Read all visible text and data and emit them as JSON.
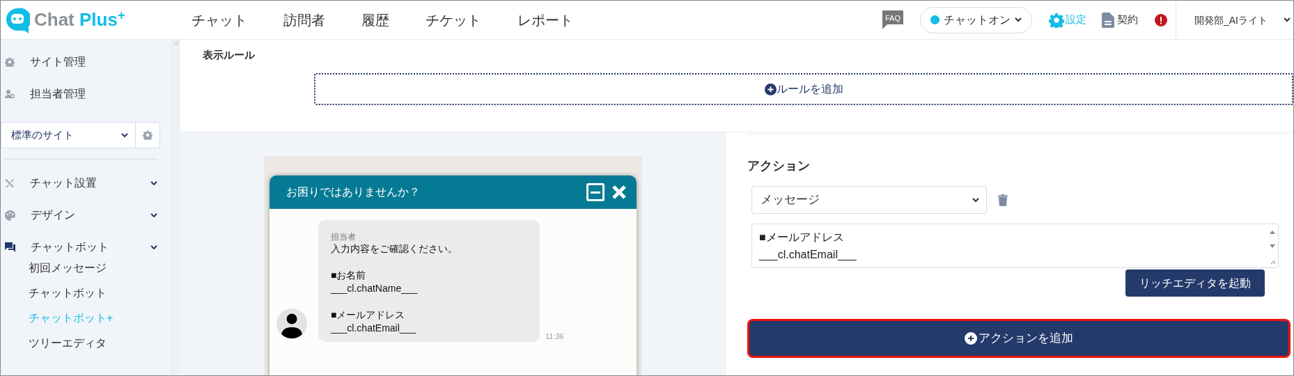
{
  "header": {
    "logo": {
      "text": "Chat Plus",
      "sup": "+"
    },
    "nav": [
      {
        "label": "チャット",
        "selected": false
      },
      {
        "label": "訪問者",
        "selected": false
      },
      {
        "label": "履歴",
        "selected": false
      },
      {
        "label": "チケット",
        "selected": false
      },
      {
        "label": "レポート",
        "selected": false
      }
    ],
    "faq": "FAQ",
    "status": {
      "label": "チャットオン",
      "color": "#12bde6"
    },
    "settings": "設定",
    "contract": "契約",
    "user": "開発部_AIライト"
  },
  "sidebar": {
    "top_items": [
      {
        "kind": "site",
        "label": "サイト管理"
      },
      {
        "kind": "staff",
        "label": "担当者管理"
      }
    ],
    "site_select": "標準のサイト",
    "menu": [
      {
        "kind": "setup",
        "label": "チャット設置"
      },
      {
        "kind": "design",
        "label": "デザイン"
      },
      {
        "kind": "bot",
        "label": "チャットボット",
        "children": [
          {
            "label": "初回メッセージ",
            "selected": false
          },
          {
            "label": "チャットボット",
            "selected": false
          },
          {
            "label": "チャットボット+",
            "selected": true
          },
          {
            "label": "ツリーエディタ",
            "selected": false
          }
        ]
      }
    ]
  },
  "display_rule": {
    "title": "表示ルール",
    "add_button": "ルールを追加"
  },
  "preview": {
    "title": "お困りではありませんか？",
    "message": {
      "sender": "担当者",
      "paragraphs": [
        "入力内容をご確認ください。",
        "■お名前\n___cl.chatName___",
        "■メールアドレス\n___cl.chatEmail___"
      ],
      "time": "11:36"
    }
  },
  "action": {
    "title": "アクション",
    "type_select": "メッセージ",
    "text": "■メールアドレス\n___cl.chatEmail___",
    "rich_editor_button": "リッチエディタを起動",
    "add_button": "アクションを追加"
  }
}
